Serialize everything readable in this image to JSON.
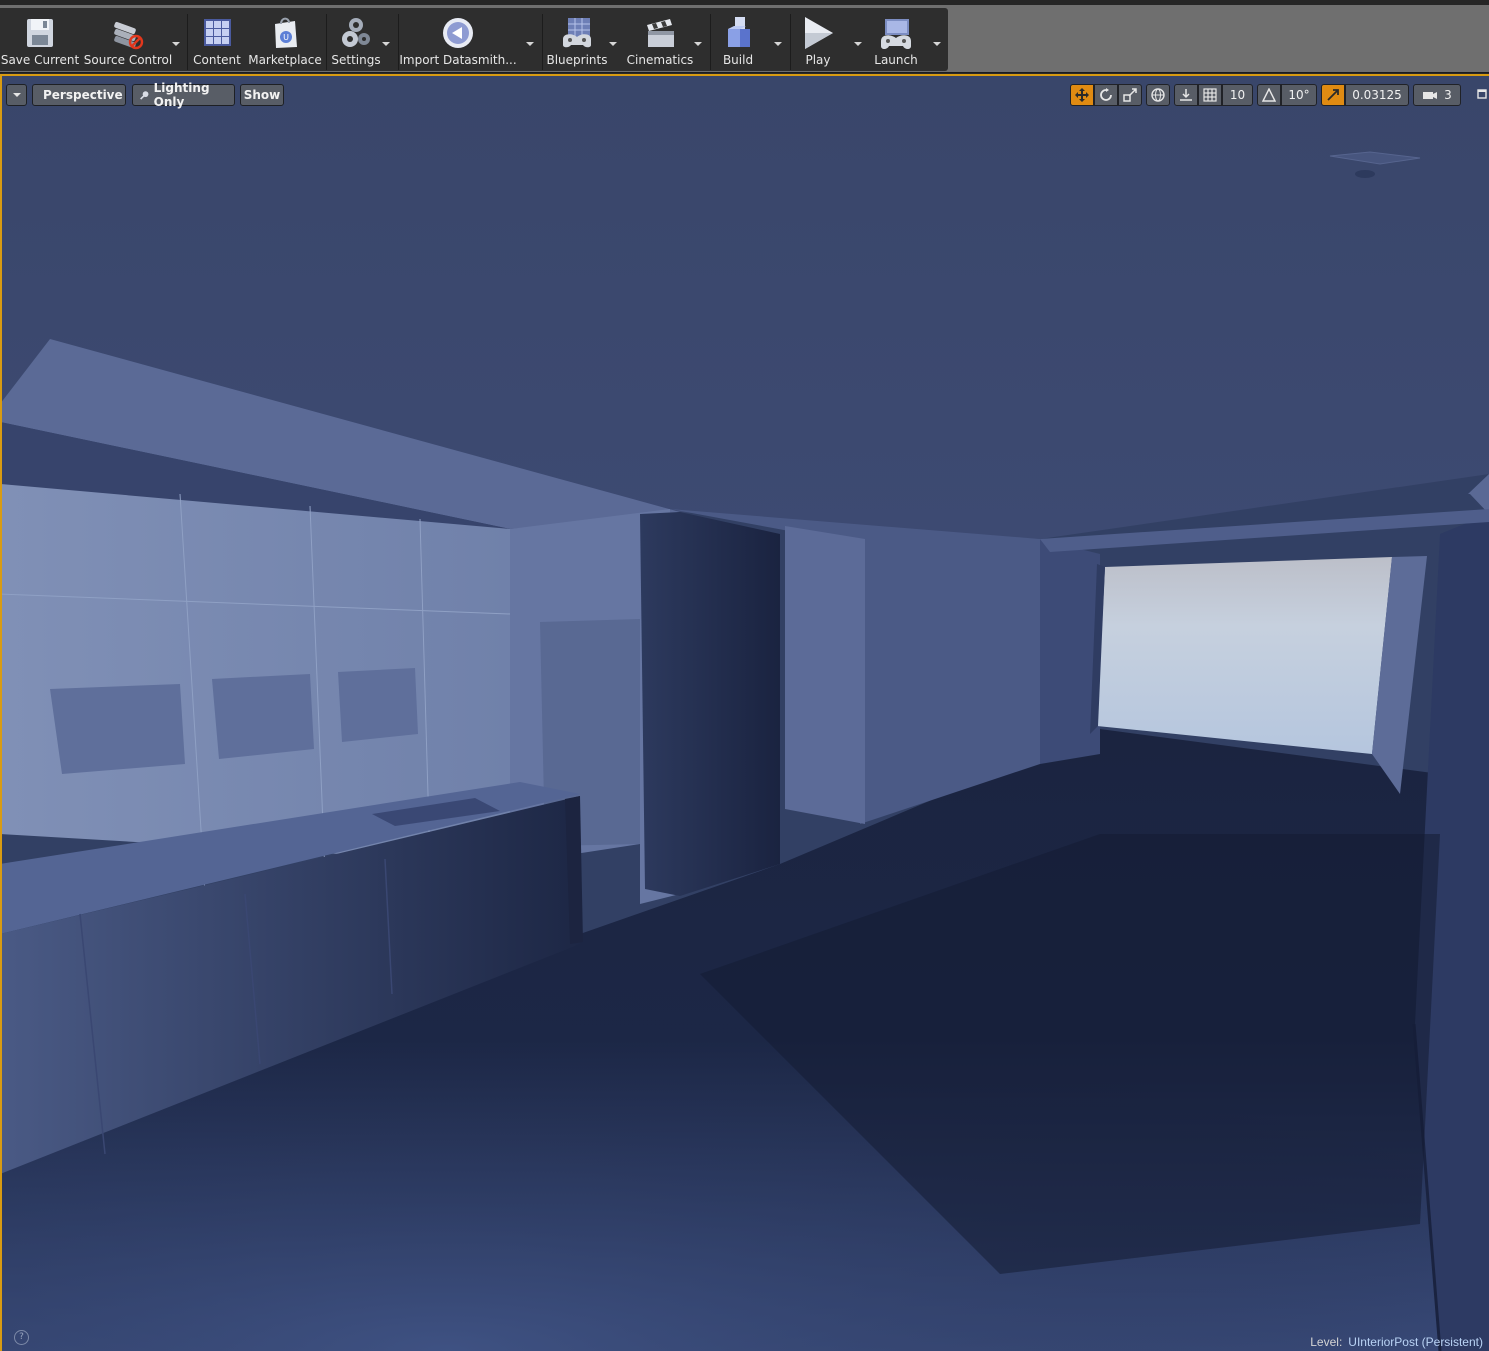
{
  "toolbar": {
    "buttons": [
      {
        "label": "Save Current",
        "icon": "save-icon"
      },
      {
        "label": "Source Control",
        "icon": "source-control-icon"
      },
      {
        "label": "Content",
        "icon": "content-browser-icon"
      },
      {
        "label": "Marketplace",
        "icon": "marketplace-icon"
      },
      {
        "label": "Settings",
        "icon": "settings-gears-icon"
      },
      {
        "label": "Import Datasmith...",
        "icon": "datasmith-icon"
      },
      {
        "label": "Blueprints",
        "icon": "blueprints-icon"
      },
      {
        "label": "Cinematics",
        "icon": "cinematics-clapper-icon"
      },
      {
        "label": "Build",
        "icon": "build-cubes-icon"
      },
      {
        "label": "Play",
        "icon": "play-icon"
      },
      {
        "label": "Launch",
        "icon": "launch-gamepad-icon"
      }
    ]
  },
  "viewport": {
    "view_mode": "Perspective",
    "lighting_mode": "Lighting Only",
    "show_label": "Show",
    "grid_snap": "10",
    "rotation_snap": "10°",
    "scale_snap": "0.03125",
    "camera_speed": "3",
    "status": {
      "level_label": "Level:",
      "level_name": "UInteriorPost (Persistent)"
    },
    "help_glyph": "?",
    "accent_color": "#d89b12",
    "active_color": "#e08b12"
  }
}
